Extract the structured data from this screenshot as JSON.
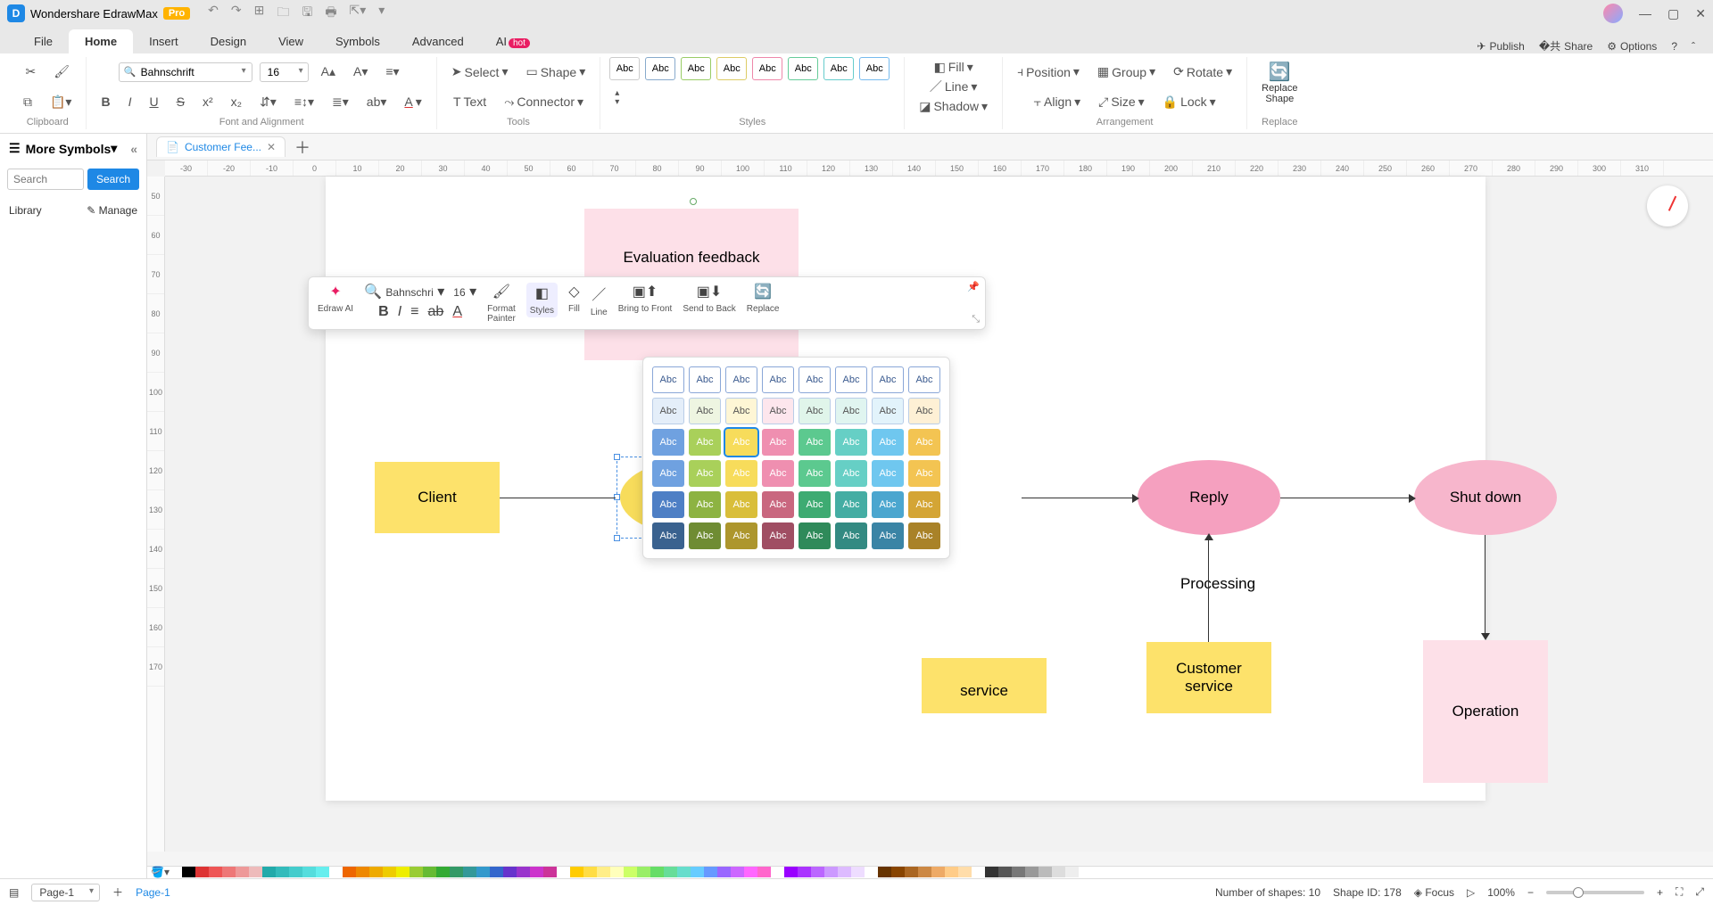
{
  "app": {
    "title": "Wondershare EdrawMax",
    "badge": "Pro"
  },
  "menubar": {
    "tabs": [
      "File",
      "Home",
      "Insert",
      "Design",
      "View",
      "Symbols",
      "Advanced",
      "AI"
    ],
    "active": 1,
    "ai_badge": "hot",
    "right": {
      "publish": "Publish",
      "share": "Share",
      "options": "Options"
    }
  },
  "ribbon": {
    "font_name": "Bahnschrift",
    "font_size": "16",
    "clipboard_label": "Clipboard",
    "font_label": "Font and Alignment",
    "tools": {
      "select": "Select",
      "shape": "Shape",
      "text": "Text",
      "connector": "Connector",
      "label": "Tools"
    },
    "styles_label": "Styles",
    "style_swatch": "Abc",
    "shape_ops": {
      "fill": "Fill",
      "line": "Line",
      "shadow": "Shadow"
    },
    "arrangement": {
      "position": "Position",
      "group": "Group",
      "rotate": "Rotate",
      "align": "Align",
      "size": "Size",
      "lock": "Lock",
      "label": "Arrangement"
    },
    "replace": {
      "label": "Replace",
      "btn": "Replace\nShape"
    }
  },
  "sidebar": {
    "title": "More Symbols",
    "search_placeholder": "Search",
    "search_btn": "Search",
    "library": "Library",
    "manage": "Manage"
  },
  "docTabs": {
    "name": "Customer Fee...",
    "page": "Page-1"
  },
  "ruler_h": [
    "-30",
    "-20",
    "-10",
    "0",
    "10",
    "20",
    "30",
    "40",
    "50",
    "60",
    "70",
    "80",
    "90",
    "100",
    "110",
    "120",
    "130",
    "140",
    "150",
    "160",
    "170",
    "180",
    "190",
    "200",
    "210",
    "220",
    "230",
    "240",
    "250",
    "260",
    "270",
    "280",
    "290",
    "300",
    "310"
  ],
  "ruler_v": [
    "50",
    "60",
    "70",
    "80",
    "90",
    "100",
    "110",
    "120",
    "130",
    "140",
    "150",
    "160",
    "170"
  ],
  "diagram": {
    "eval_feedback": "Evaluation feedback",
    "client": "Client",
    "reply": "Reply",
    "shutdown": "Shut down",
    "processing": "Processing",
    "cust_service": "Customer\nservice",
    "operation": "Operation",
    "partial_service": "service"
  },
  "float_toolbar": {
    "font": "Bahnschri",
    "size": "16",
    "edraw_ai": "Edraw AI",
    "format_painter": "Format\nPainter",
    "styles": "Styles",
    "fill": "Fill",
    "line": "Line",
    "bring_front": "Bring to Front",
    "send_back": "Send to Back",
    "replace": "Replace"
  },
  "palette_label": "Abc",
  "chart_data": {
    "type": "table",
    "title": "Shape Styles palette",
    "rows": 6,
    "cols": 8,
    "cell_label": "Abc",
    "selected": [
      2,
      2
    ],
    "row_fills": [
      [
        "#ffffff",
        "#ffffff",
        "#ffffff",
        "#ffffff",
        "#ffffff",
        "#ffffff",
        "#ffffff",
        "#ffffff"
      ],
      [
        "#e4eef9",
        "#eef5e1",
        "#fef6d5",
        "#fde6ed",
        "#e0f5ea",
        "#e0f5f0",
        "#e2f3fb",
        "#fef0d5"
      ],
      [
        "#6fa1e0",
        "#a9d05a",
        "#f7dc5b",
        "#ef8fb0",
        "#5cc98f",
        "#66cfc5",
        "#6fc7ef",
        "#f3c452"
      ],
      [
        "#6fa1e0",
        "#a9d05a",
        "#f7dc5b",
        "#ef8fb0",
        "#5cc98f",
        "#66cfc5",
        "#6fc7ef",
        "#f3c452"
      ],
      [
        "#4e7fc5",
        "#8db342",
        "#d9be3a",
        "#c9677f",
        "#3eab72",
        "#44ada3",
        "#4ba6cf",
        "#d4a535"
      ],
      [
        "#3a628f",
        "#6f8c33",
        "#ad962d",
        "#a04e63",
        "#2f8a5a",
        "#338a82",
        "#3a84a5",
        "#a98228"
      ]
    ],
    "row_text_colors": [
      "#3a5a8f",
      "#555",
      "#fff",
      "#fff",
      "#fff",
      "#fff"
    ],
    "row_borders": [
      "1px solid #8aa7d8",
      "1px solid #b9cde7",
      null,
      null,
      null,
      null
    ]
  },
  "color_strip": [
    "#fff",
    "#000",
    "#d33",
    "#e55",
    "#e77",
    "#e99",
    "#ebb",
    "#2aa",
    "#3bb",
    "#4cc",
    "#5dd",
    "#6ee",
    "#fff",
    "#e60",
    "#e80",
    "#ea0",
    "#ec0",
    "#ee0",
    "#9c3",
    "#6b3",
    "#3a3",
    "#396",
    "#399",
    "#39c",
    "#36c",
    "#63c",
    "#93c",
    "#c3c",
    "#c39",
    "#fff",
    "#fc0",
    "#fd4",
    "#fe8",
    "#ffb",
    "#cf6",
    "#9e6",
    "#6d6",
    "#6d9",
    "#6dc",
    "#6cf",
    "#69f",
    "#96f",
    "#c6f",
    "#f6f",
    "#f6c",
    "#fff",
    "#90f",
    "#a3f",
    "#b6f",
    "#c9f",
    "#dbf",
    "#edf",
    "#fff",
    "#630",
    "#840",
    "#a62",
    "#c84",
    "#ea6",
    "#fc8",
    "#fda",
    "#fff",
    "#333",
    "#555",
    "#777",
    "#999",
    "#bbb",
    "#ddd",
    "#eee",
    "#fff"
  ],
  "status": {
    "page_select": "Page-1",
    "page_tab": "Page-1",
    "shapes": "Number of shapes: 10",
    "shape_id": "Shape ID: 178",
    "focus": "Focus",
    "zoom": "100%"
  }
}
